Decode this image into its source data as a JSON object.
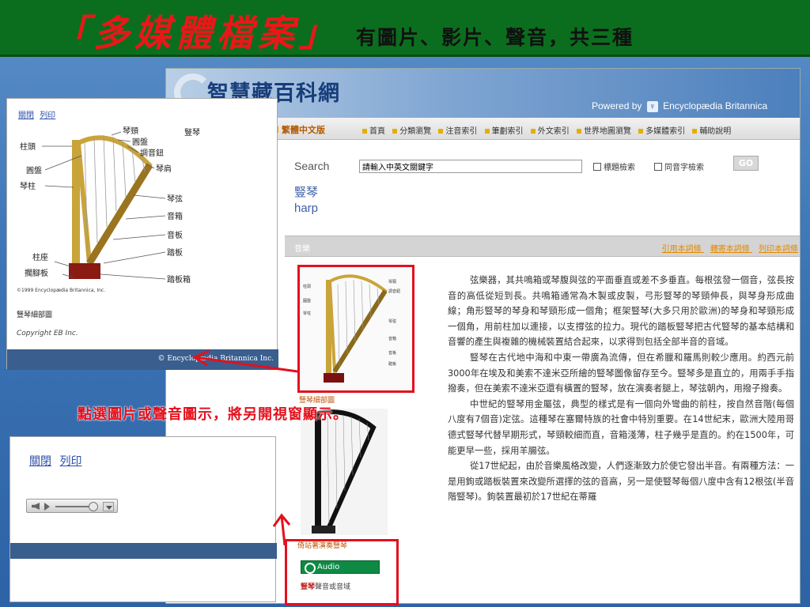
{
  "slide": {
    "title_main": "「多媒體檔案」",
    "title_sub": "有圖片、影片、聲音，共三種",
    "callout": "點選圖片或聲音圖示，將另開視窗顯示。"
  },
  "site": {
    "name": "智慧藏百科網",
    "powered_by": "Powered by",
    "powered_brand": "Encyclopædia Britannica",
    "edition": "繁體中文版",
    "nav_items": [
      "首頁",
      "分類瀏覽",
      "注音索引",
      "筆劃索引",
      "外文索引",
      "世界地圖瀏覽",
      "多媒體索引",
      "輔助說明"
    ],
    "search": {
      "label": "Search",
      "placeholder": "請輸入中英文關鍵字",
      "opt_title": "標題檢索",
      "opt_homophone": "同音字檢索",
      "go": "GO"
    }
  },
  "entry": {
    "title_zh": "豎琴",
    "title_en": "harp",
    "category": "音樂",
    "actions": [
      "引用本詞條",
      "轉寄本詞條",
      "列印本詞條"
    ],
    "thumb_caption": "豎琴細部圖",
    "media_caption": "倚站著演奏豎琴",
    "audio_label": "Audio",
    "audio_caption_term": "豎琴",
    "audio_caption_rest": "聲音或音域",
    "paragraphs": [
      "弦樂器，其共鳴箱或琴腹與弦的平面垂直或差不多垂直。每根弦發一個音，弦長按音的高低從短到長。共鳴箱通常為木製或皮製，弓形豎琴的琴頸伸長，與琴身形成曲線；角形豎琴的琴身和琴頸形成一個角；框架豎琴(大多只用於歐洲)的琴身和琴頸形成一個角，用前柱加以連接，以支撐弦的拉力。現代的踏板豎琴把古代豎琴的基本結構和音響的產生與複雜的機械裝置結合起來，以求得到包括全部半音的音域。",
      "豎琴在古代地中海和中東一帶廣為流傳，但在希臘和羅馬則較少應用。約西元前3000年在埃及和美索不達米亞所繪的豎琴圖像留存至今。豎琴多是直立的，用兩手手指撥奏，但在美索不達米亞還有橫置的豎琴，放在演奏者腿上，琴弦朝內，用撥子撥奏。",
      "中世紀的豎琴用金屬弦，典型的樣式是有一個向外彎曲的前柱，按自然音階(每個八度有7個音)定弦。這種琴在塞爾特族的社會中特別重要。在14世紀末，歐洲大陸用哥德式豎琴代替早期形式，琴頸較細而直，音箱淺薄，柱子幾乎是直的。約在1500年，可能更早一些，採用羊腸弦。",
      "從17世紀起，由於音樂風格改變，人們逐漸致力於使它發出半音。有兩種方法：一是用鉤或踏板裝置來改變所選擇的弦的音高，另一是使豎琴每個八度中含有12根弦(半音階豎琴)。鉤裝置最初於17世紀在蒂羅"
    ]
  },
  "popup_image": {
    "close": "關閉",
    "print": "列印",
    "labels": [
      "柱頭",
      "琴頸",
      "圓盤",
      "調音鈕",
      "豎琴",
      "圓盤",
      "琴肩",
      "琴柱",
      "琴弦",
      "音箱",
      "音板",
      "柱座",
      "踏板",
      "擱腳板",
      "踏板箱"
    ],
    "diagram_copyright": "©1999 Encyclopædia Britannica, Inc.",
    "caption": "豎琴細部圖",
    "copyright": "Copyright EB Inc.",
    "footer": "© Encyclopædia Britannica Inc."
  },
  "popup_audio": {
    "close": "關閉",
    "print": "列印"
  },
  "colors": {
    "title_red": "#e81818",
    "header_green": "#0b6e1e",
    "highlight_red": "#e3101d",
    "harp_gold": "#c9a43a"
  }
}
